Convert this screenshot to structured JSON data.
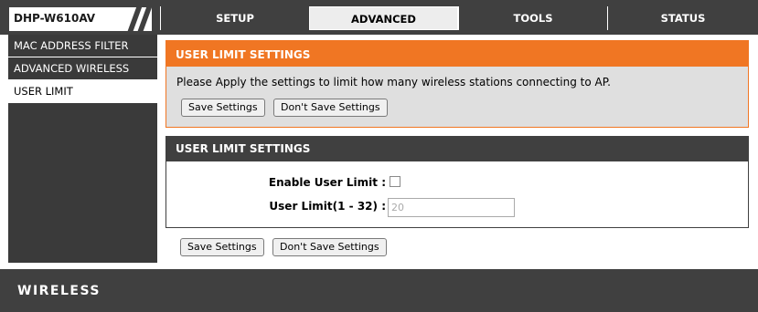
{
  "model": "DHP-W610AV",
  "tabs": [
    {
      "label": "SETUP",
      "active": false
    },
    {
      "label": "ADVANCED",
      "active": true
    },
    {
      "label": "TOOLS",
      "active": false
    },
    {
      "label": "STATUS",
      "active": false
    }
  ],
  "sidebar": {
    "items": [
      {
        "label": "MAC ADDRESS FILTER",
        "active": false
      },
      {
        "label": "ADVANCED WIRELESS",
        "active": false
      },
      {
        "label": "USER LIMIT",
        "active": true
      }
    ]
  },
  "intro": {
    "title": "USER LIMIT SETTINGS",
    "description": "Please Apply the settings to limit how many wireless stations connecting to AP.",
    "save_label": "Save Settings",
    "dont_save_label": "Don't Save Settings"
  },
  "settings": {
    "title": "USER LIMIT SETTINGS",
    "enable_label": "Enable User Limit :",
    "enable_checked": false,
    "limit_label": "User Limit(1 - 32) :",
    "limit_value": "20"
  },
  "bottom": {
    "save_label": "Save Settings",
    "dont_save_label": "Don't Save Settings"
  },
  "footer": {
    "brand": "WIRELESS"
  },
  "colors": {
    "dark": "#404040",
    "accent_orange": "#f07623",
    "panel_gray": "#dfdfdf"
  }
}
